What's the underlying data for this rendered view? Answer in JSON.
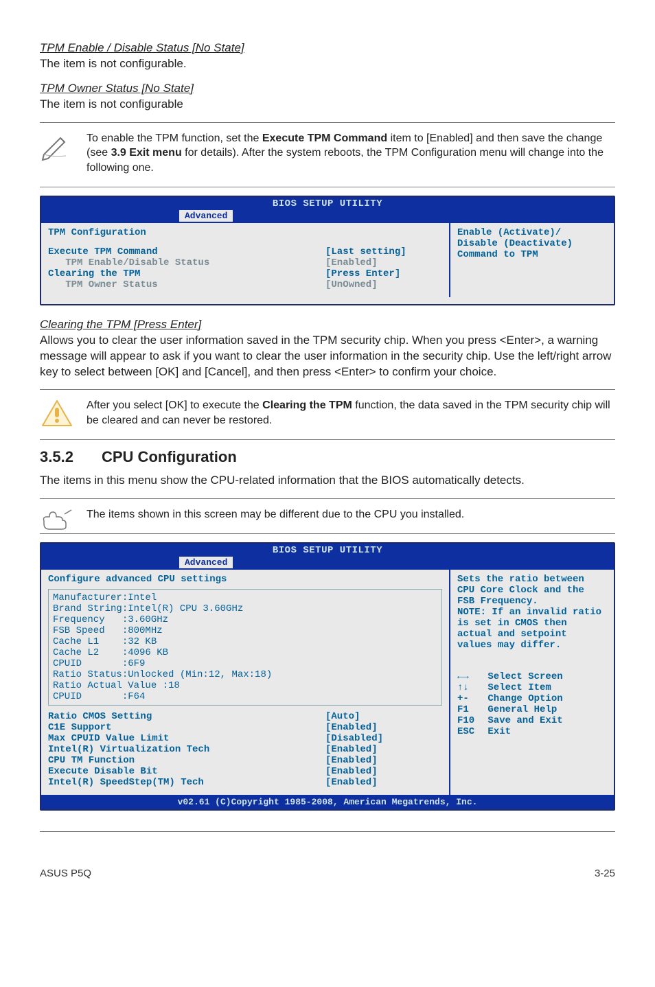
{
  "tpm_enable_disable": {
    "heading": "TPM Enable / Disable Status [No State]",
    "text": "The item is not configurable."
  },
  "tpm_owner": {
    "heading": "TPM Owner Status [No State]",
    "text": "The item is not configurable"
  },
  "note1": {
    "text_before": "To enable the TPM function, set the ",
    "bold1": "Execute TPM Command",
    "text_mid1": " item to [Enabled] and then save the change (see ",
    "bold2": "3.9 Exit menu",
    "text_after": " for details). After the system reboots, the TPM Configuration menu will change into the following one."
  },
  "bios1": {
    "title": "BIOS SETUP UTILITY",
    "tab": "Advanced",
    "panel_title": "TPM Configuration",
    "rows": [
      {
        "label": "Execute TPM Command",
        "value": "[Last setting]",
        "lcls": "blue",
        "vcls": "blue",
        "indent": ""
      },
      {
        "label": "TPM Enable/Disable Status",
        "value": "[Enabled]",
        "lcls": "gray",
        "vcls": "gray",
        "indent": "   "
      },
      {
        "label": "Clearing the TPM",
        "value": "[Press Enter]",
        "lcls": "blue",
        "vcls": "blue",
        "indent": ""
      },
      {
        "label": "TPM Owner Status",
        "value": "[UnOwned]",
        "lcls": "gray",
        "vcls": "gray",
        "indent": "   "
      }
    ],
    "help": "Enable (Activate)/\nDisable (Deactivate)\nCommand to TPM"
  },
  "clearing": {
    "heading": "Clearing the TPM [Press Enter]",
    "text": "Allows you to clear the user information saved in the TPM security chip. When you press <Enter>, a warning message will appear to ask if you want to clear the user information in the security chip. Use the left/right arrow key to select between [OK] and [Cancel], and then press <Enter> to confirm your choice."
  },
  "warn_note": {
    "before": "After you select [OK] to execute the ",
    "bold": "Clearing the TPM",
    "after": " function, the data saved in the TPM security chip will be cleared and can never be restored."
  },
  "section352": {
    "num": "3.5.2",
    "title": "CPU Configuration",
    "intro": "The items in this menu show the CPU-related information that the BIOS automatically detects."
  },
  "note2": "The items shown in this screen may be different due to the CPU you installed.",
  "bios2": {
    "title": "BIOS SETUP UTILITY",
    "tab": "Advanced",
    "panel_title": "Configure advanced CPU settings",
    "info": [
      "Manufacturer:Intel",
      "Brand String:Intel(R) CPU 3.60GHz",
      "Frequency   :3.60GHz",
      "FSB Speed   :800MHz",
      "Cache L1    :32 KB",
      "Cache L2    :4096 KB",
      "CPUID       :6F9",
      "Ratio Status:Unlocked (Min:12, Max:18)",
      "Ratio Actual Value :18",
      "CPUID       :F64"
    ],
    "rows": [
      {
        "label": "Ratio CMOS Setting",
        "value": "[Auto]"
      },
      {
        "label": "C1E Support",
        "value": "[Enabled]"
      },
      {
        "label": "Max CPUID Value Limit",
        "value": "[Disabled]"
      },
      {
        "label": "Intel(R) Virtualization Tech",
        "value": "[Enabled]"
      },
      {
        "label": "CPU TM Function",
        "value": "[Enabled]"
      },
      {
        "label": "Execute Disable Bit",
        "value": "[Enabled]"
      },
      {
        "label": "Intel(R) SpeedStep(TM) Tech",
        "value": "[Enabled]"
      }
    ],
    "help_top": "Sets the ratio between CPU Core Clock and the FSB Frequency.\nNOTE: If an invalid ratio is set in CMOS then actual and setpoint values may differ.",
    "help_keys": [
      {
        "k": "←→",
        "t": "Select Screen"
      },
      {
        "k": "↑↓",
        "t": "Select Item"
      },
      {
        "k": "+-",
        "t": "Change Option"
      },
      {
        "k": "F1",
        "t": "General Help"
      },
      {
        "k": "F10",
        "t": "Save and Exit"
      },
      {
        "k": "ESC",
        "t": "Exit"
      }
    ],
    "footer": "v02.61 (C)Copyright 1985-2008, American Megatrends, Inc."
  },
  "page_footer": {
    "left": "ASUS P5Q",
    "right": "3-25"
  }
}
